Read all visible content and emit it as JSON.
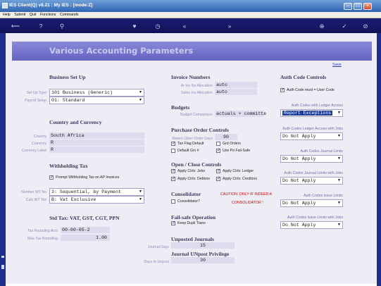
{
  "window": {
    "title": "IES Client(Q) v8.21 : My IES :     [mode:Z]"
  },
  "menu": [
    "Help",
    "Submit",
    "Quit",
    "Functions",
    "Commands"
  ],
  "page": {
    "title": "Various Accounting Parameters",
    "save_label": "Save"
  },
  "business_setup": {
    "heading": "Business Set Up",
    "set_up_type": {
      "label": "Set Up Type",
      "value": "101 Business (Generic)"
    },
    "payroll_setup": {
      "label": "Payroll Setup",
      "value": "01: Standard"
    }
  },
  "country_currency": {
    "heading": "Country and Currency",
    "country": {
      "label": "Country",
      "value": "South Africa"
    },
    "currency": {
      "label": "Currency",
      "value": "R"
    },
    "currency_label": {
      "label": "Currency Label",
      "value": "R"
    }
  },
  "withholding_tax": {
    "heading": "Withholding Tax",
    "prompt": {
      "label": "Prompt Withholding Tax on AP Invoices",
      "checked": true
    },
    "number_wt_type": {
      "label": "Number WT No",
      "value": "3: Sequential, by Payment"
    },
    "calc_wt_type": {
      "label": "Calc WT Tax",
      "value": "B: Vat Exclusive"
    }
  },
  "std_tax": {
    "heading": "Std Tax: VAT, GST, CGT, PPN",
    "tax_rounding_acct": {
      "label": "Tax Rounding Acct",
      "value": "00-00-05-2"
    },
    "max_tax_rounding": {
      "label": "Max Tax Rounding",
      "value": "1.00"
    }
  },
  "invoice_numbers": {
    "heading": "Invoice Numbers",
    "ar_inv_no": {
      "label": "Ar Inv No Allocation",
      "value": "auto"
    },
    "sales_inv_no": {
      "label": "Sales Inv Allocation",
      "value": "auto"
    }
  },
  "budgets": {
    "heading": "Budgets",
    "budget_comparison": {
      "label": "Budget Comparison",
      "value": "actuals + committe"
    }
  },
  "purchase_order": {
    "heading": "Purchase Order Controls",
    "return_open_order_days": {
      "label": "Return Open Order Days",
      "value": "90"
    },
    "checks": [
      {
        "label": "Tax Flag Default",
        "checked": true
      },
      {
        "label": "Grd Orders",
        "checked": false
      },
      {
        "label": "Default Grv #",
        "checked": false
      },
      {
        "label": "Use Po Fail-Safe",
        "checked": true
      }
    ]
  },
  "open_close": {
    "heading": "Open / Close Controls",
    "checks": [
      {
        "label": "Apply Ctrls: Jobs",
        "checked": true
      },
      {
        "label": "Apply Ctrls: Ledger",
        "checked": true
      },
      {
        "label": "Apply Ctrls: Debtors",
        "checked": true
      },
      {
        "label": "Apply Ctrls: Creditors",
        "checked": true
      }
    ]
  },
  "consolidator": {
    "heading": "Consolidator",
    "warning_line1": "CAUTION: ONLY IF INDEED A",
    "warning_line2": "CONSOLIDATOR !",
    "check": {
      "label": "Consolidator?",
      "checked": false
    }
  },
  "failsafe": {
    "heading": "Fail-safe Operation",
    "check": {
      "label": "Keep Dupli Trans",
      "checked": true
    }
  },
  "unposted": {
    "heading": "Unposted Journals",
    "days": {
      "label": "Journal Days",
      "value": "15"
    }
  },
  "unpost_priv": {
    "heading": "Journal UNpost Privilege",
    "days": {
      "label": "Days to Unpost",
      "value": "30"
    }
  },
  "auth_codes": {
    "heading": "Auth Code Controls",
    "auth_code_must_user_code": {
      "label": "Auth Code must = User Code",
      "checked": true
    },
    "with_ledger_access": {
      "label": "Auth Codes with Ledger Access",
      "value": "Report Exceptions"
    },
    "ledger_access_with_jobs": {
      "label": "Auth Codes Ledger Access with Jobs",
      "value": "Do Not Apply"
    },
    "journal_limits": {
      "label": "Auth Codes Journal Limits",
      "value": "Do Not Apply"
    },
    "journal_limits_with_jobs": {
      "label": "Auth Codes Journal Limits with Jobs",
      "value": "Do Not Apply"
    },
    "issue_limits": {
      "label": "Auth Codes Issue Limits",
      "value": "Do Not Apply"
    },
    "issue_limits_with_jobs": {
      "label": "Auth Codes Issue Limits with Jobs",
      "value": "Do Not Apply"
    }
  },
  "icons": [
    "back-arrow-icon",
    "help-icon",
    "search-icon",
    "heart-icon",
    "clock-icon",
    "rewind-icon",
    "fast-forward-icon",
    "plus-icon",
    "check-icon",
    "cancel-icon"
  ]
}
